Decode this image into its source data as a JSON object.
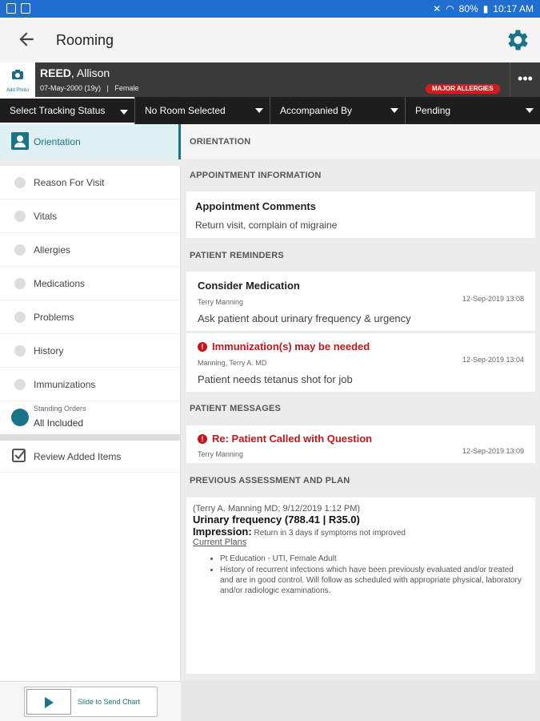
{
  "status": {
    "battery": "80%",
    "time": "10:17 AM"
  },
  "appbar": {
    "title": "Rooming"
  },
  "patient": {
    "add_photo_label": "Add Photo",
    "last_name": "REED",
    "first_name": ", Allison",
    "meta": "07-May-2000 (19y)   |   Female",
    "allergy_badge": "MAJOR ALLERGIES"
  },
  "filters": [
    {
      "label": "Select Tracking Status"
    },
    {
      "label": "No Room Selected"
    },
    {
      "label": "Accompanied By"
    },
    {
      "label": "Pending"
    }
  ],
  "nav": {
    "active": "Orientation",
    "items": [
      "Reason For Visit",
      "Vitals",
      "Allergies",
      "Medications",
      "Problems",
      "History",
      "Immunizations"
    ],
    "standing_orders": {
      "title": "Standing Orders",
      "value": "All Included"
    },
    "review": "Review Added Items",
    "slide": "Slide to Send Chart"
  },
  "main": {
    "section_orientation": "ORIENTATION",
    "section_appointment": "APPOINTMENT INFORMATION",
    "appointment": {
      "title": "Appointment Comments",
      "body": "Return visit, complain of migraine"
    },
    "section_reminders": "PATIENT REMINDERS",
    "reminders": [
      {
        "title": "Consider Medication",
        "author": "Terry Manning",
        "timestamp": "12-Sep-2019 13:08",
        "body": "Ask patient about urinary frequency & urgency"
      },
      {
        "title": "Immunization(s) may be needed",
        "author": "Manning, Terry A. MD",
        "timestamp": "12-Sep-2019 13:04",
        "body": "Patient needs tetanus shot for job"
      }
    ],
    "section_messages": "PATIENT MESSAGES",
    "message": {
      "title": "Re: Patient Called with Question",
      "author": "Terry Manning",
      "timestamp": "12-Sep-2019 13:09"
    },
    "section_plan": "PREVIOUS ASSESSMENT AND PLAN",
    "plan": {
      "byline": "(Terry A. Manning MD; 9/12/2019 1:12 PM)",
      "diagnosis": "Urinary frequency (788.41 | R35.0)",
      "impression_label": "Impression:",
      "impression_text": " Return in 3 days if symptoms not improved",
      "current_plans": "Current Plans",
      "bullets": [
        "Pt Education - UTI, Female Adult",
        "History of recurrent infections which have been previously evaluated and/or treated and are in good control. Will follow as scheduled with appropriate physical, laboratory and/or radiologic examinations."
      ]
    }
  },
  "colors": {
    "accent": "#1b7387",
    "alert": "#c6141a",
    "statusbar": "#1f6ed0"
  }
}
